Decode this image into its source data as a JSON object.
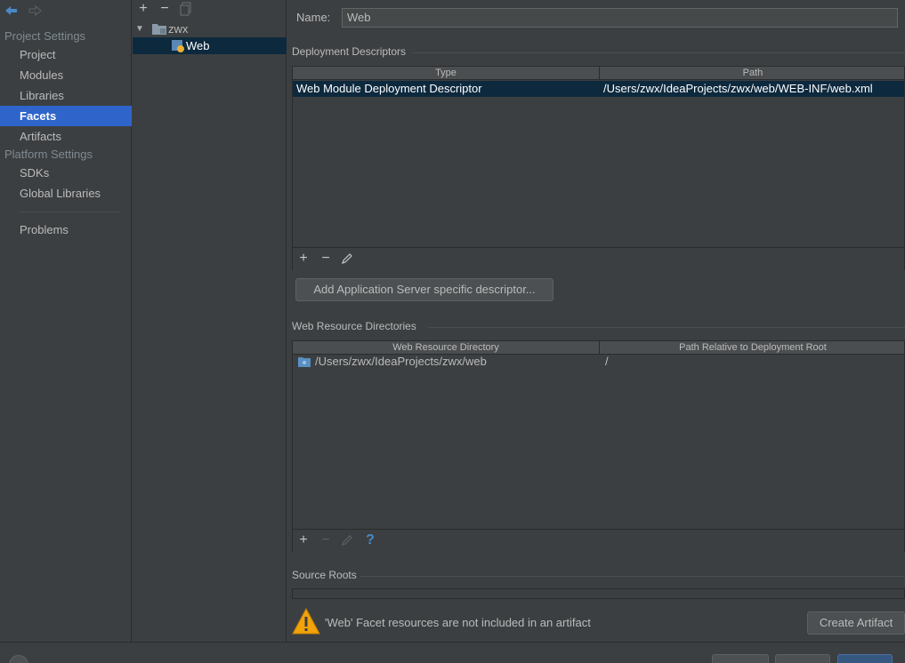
{
  "sidebar": {
    "headings": {
      "project": "Project Settings",
      "platform": "Platform Settings"
    },
    "project_items": [
      "Project",
      "Modules",
      "Libraries",
      "Facets",
      "Artifacts"
    ],
    "platform_items": [
      "SDKs",
      "Global Libraries"
    ],
    "problems": "Problems",
    "selected": "Facets"
  },
  "tree": {
    "toolbar": {
      "add": "+",
      "remove": "−"
    },
    "nodes": [
      {
        "label": "zwx",
        "level": 0,
        "expanded": true
      },
      {
        "label": "Web",
        "level": 1,
        "selected": true
      }
    ]
  },
  "facet": {
    "name_label": "Name:",
    "name_value": "Web",
    "deployment": {
      "title": "Deployment Descriptors",
      "columns": [
        "Type",
        "Path"
      ],
      "rows": [
        {
          "type": "Web Module Deployment Descriptor",
          "path": "/Users/zwx/IdeaProjects/zwx/web/WEB-INF/web.xml"
        }
      ],
      "toolbar": {
        "add": "+",
        "remove": "−"
      },
      "add_server_button": "Add Application Server specific descriptor..."
    },
    "resources": {
      "title": "Web Resource Directories",
      "columns": [
        "Web Resource Directory",
        "Path Relative to Deployment Root"
      ],
      "rows": [
        {
          "directory": "/Users/zwx/IdeaProjects/zwx/web",
          "relative": "/"
        }
      ],
      "toolbar": {
        "add": "+",
        "remove": "−",
        "help": "?"
      }
    },
    "source_roots": {
      "title": "Source Roots"
    },
    "warning": {
      "text": "'Web' Facet resources are not included in an artifact",
      "button": "Create Artifact"
    }
  },
  "colors": {
    "background": "#3c3f41",
    "selection": "#2f65ca",
    "row_selection": "#0d293e",
    "warning": "#f0a30a"
  }
}
